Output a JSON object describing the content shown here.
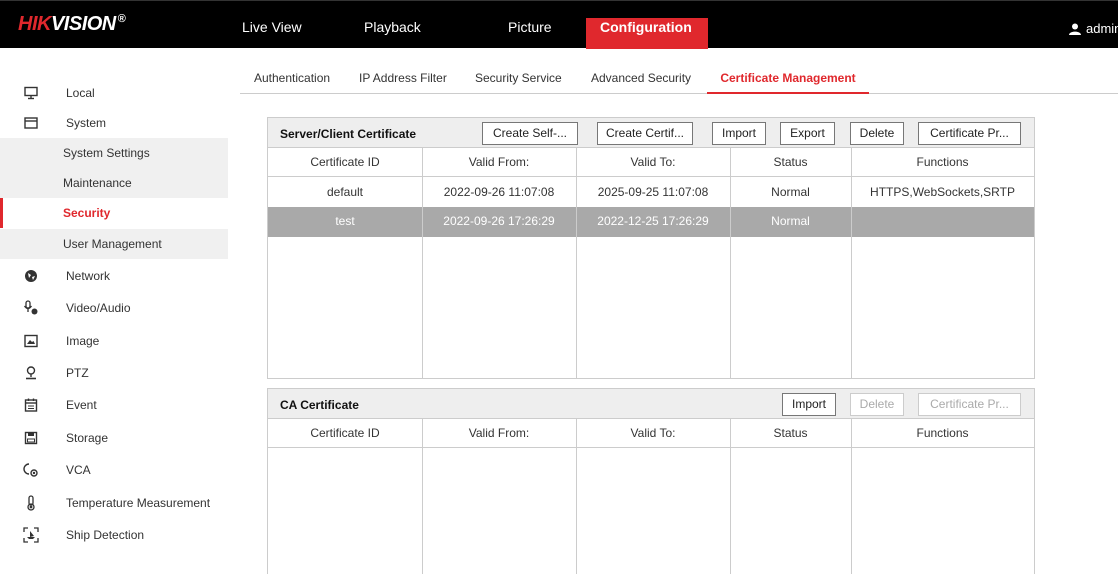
{
  "brand": {
    "name_red": "HIK",
    "name_white": "VISION",
    "reg": "®"
  },
  "topnav": [
    {
      "label": "Live View"
    },
    {
      "label": "Playback"
    },
    {
      "label": "Picture"
    },
    {
      "label": "Configuration"
    }
  ],
  "user": {
    "name": "admin"
  },
  "sidebar": {
    "items": [
      {
        "label": "Local",
        "icon": "monitor-icon"
      },
      {
        "label": "System",
        "icon": "system-icon"
      },
      {
        "label": "Network",
        "icon": "globe-icon"
      },
      {
        "label": "Video/Audio",
        "icon": "microphone-icon"
      },
      {
        "label": "Image",
        "icon": "image-icon"
      },
      {
        "label": "PTZ",
        "icon": "ptz-icon"
      },
      {
        "label": "Event",
        "icon": "calendar-icon"
      },
      {
        "label": "Storage",
        "icon": "storage-icon"
      },
      {
        "label": "VCA",
        "icon": "vca-icon"
      },
      {
        "label": "Temperature Measurement",
        "icon": "thermometer-icon"
      },
      {
        "label": "Ship Detection",
        "icon": "ship-detection-icon"
      }
    ],
    "system_sub": [
      {
        "label": "System Settings"
      },
      {
        "label": "Maintenance"
      },
      {
        "label": "Security"
      },
      {
        "label": "User Management"
      }
    ]
  },
  "tabs": [
    {
      "label": "Authentication"
    },
    {
      "label": "IP Address Filter"
    },
    {
      "label": "Security Service"
    },
    {
      "label": "Advanced Security"
    },
    {
      "label": "Certificate Management"
    }
  ],
  "server_cert": {
    "title": "Server/Client Certificate",
    "buttons": {
      "create_self": "Create Self-...",
      "create_cert": "Create Certif...",
      "import": "Import",
      "export": "Export",
      "delete": "Delete",
      "cert_props": "Certificate Pr..."
    },
    "columns": [
      "Certificate ID",
      "Valid From:",
      "Valid To:",
      "Status",
      "Functions"
    ],
    "rows": [
      {
        "id": "default",
        "from": "2022-09-26 11:07:08",
        "to": "2025-09-25 11:07:08",
        "status": "Normal",
        "functions": "HTTPS,WebSockets,SRTP"
      },
      {
        "id": "test",
        "from": "2022-09-26 17:26:29",
        "to": "2022-12-25 17:26:29",
        "status": "Normal",
        "functions": ""
      }
    ]
  },
  "ca_cert": {
    "title": "CA Certificate",
    "buttons": {
      "import": "Import",
      "delete": "Delete",
      "cert_props": "Certificate Pr..."
    },
    "columns": [
      "Certificate ID",
      "Valid From:",
      "Valid To:",
      "Status",
      "Functions"
    ]
  },
  "colors": {
    "accent": "#e0282d",
    "topbar": "#000000",
    "selected_row": "#a9a9a9"
  }
}
